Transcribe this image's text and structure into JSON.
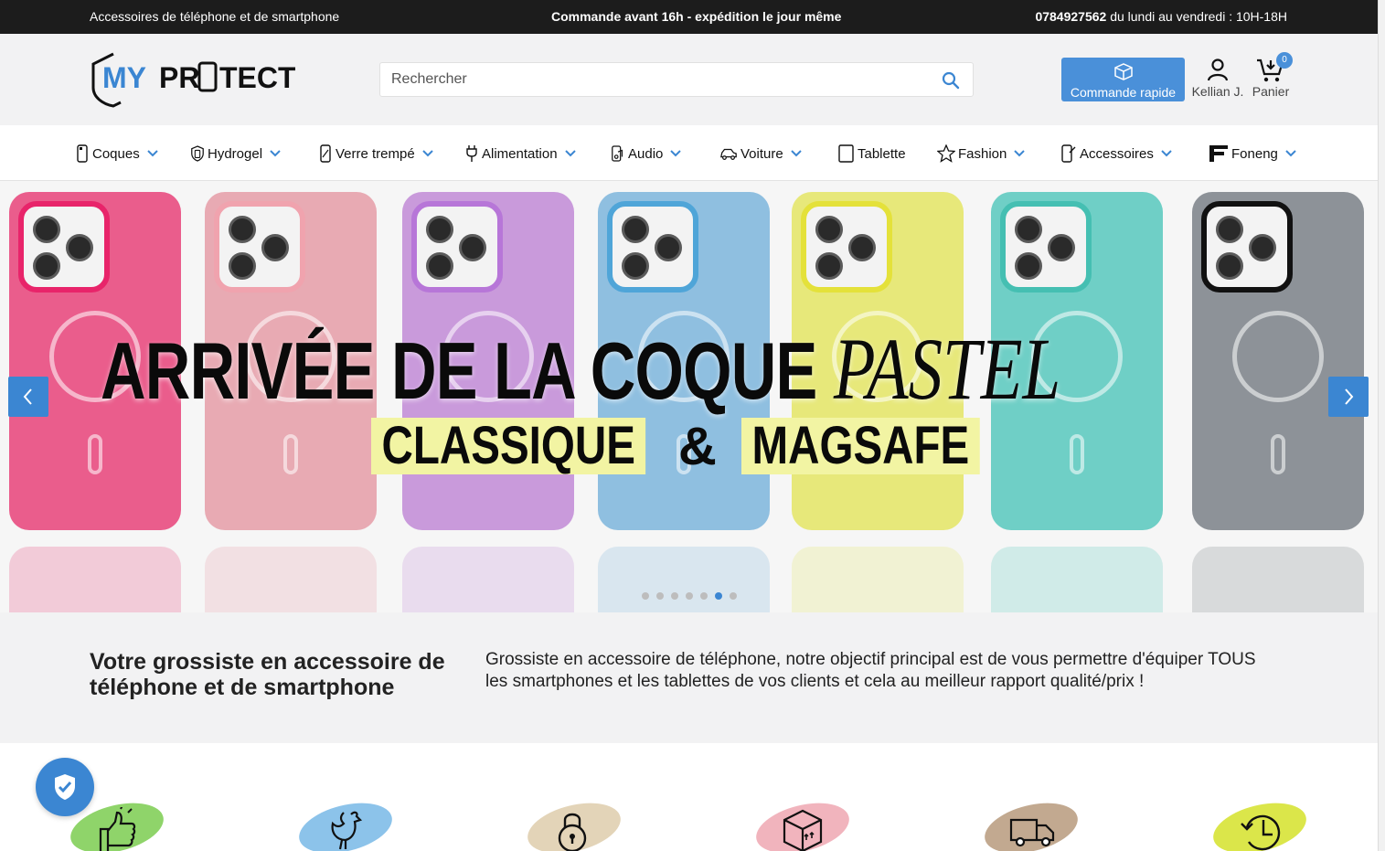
{
  "topbar": {
    "left_text": "Accessoires de téléphone et de smartphone",
    "center_text": "Commande avant 16h - expédition le jour même",
    "phone": "0784927562",
    "hours": " du lundi au vendredi : 10H-18H"
  },
  "header": {
    "logo_text": "MY PROTECT",
    "search_placeholder": "Rechercher",
    "quick_order_label": "Commande rapide",
    "account_label": "Kellian J.",
    "cart_label": "Panier",
    "cart_count": "0"
  },
  "nav": {
    "items": [
      {
        "label": "Coques",
        "icon": "phone-case-icon",
        "has_dropdown": true
      },
      {
        "label": "Hydrogel",
        "icon": "shield-icon",
        "has_dropdown": true
      },
      {
        "label": "Verre trempé",
        "icon": "tempered-glass-icon",
        "has_dropdown": true
      },
      {
        "label": "Alimentation",
        "icon": "charger-plug-icon",
        "has_dropdown": true
      },
      {
        "label": "Audio",
        "icon": "audio-icon",
        "has_dropdown": true
      },
      {
        "label": "Voiture",
        "icon": "car-icon",
        "has_dropdown": true
      },
      {
        "label": "Tablette",
        "icon": "tablet-icon",
        "has_dropdown": false
      },
      {
        "label": "Fashion",
        "icon": "star-icon",
        "has_dropdown": true
      },
      {
        "label": "Accessoires",
        "icon": "accessories-icon",
        "has_dropdown": true
      },
      {
        "label": "Foneng",
        "icon": "foneng-logo-icon",
        "has_dropdown": true
      }
    ]
  },
  "hero": {
    "headline_main": "ARRIVÉE DE LA COQUE ",
    "headline_italic": "PASTEL",
    "tag_left": "CLASSIQUE",
    "tag_amp": "&",
    "tag_right": "MAGSAFE",
    "slide_count": 7,
    "active_slide": 6,
    "case_colors": [
      "#ea5d8c",
      "#e8aab3",
      "#c99adb",
      "#8fbfe0",
      "#e7e87a",
      "#6fcfc6",
      "#8d9298"
    ],
    "bumper_colors": [
      "#e8246a",
      "#f0a3ae",
      "#b776d8",
      "#4fa5d8",
      "#e4e13a",
      "#45bfb2",
      "#111111"
    ]
  },
  "intro": {
    "title": "Votre grossiste en accessoire de téléphone et de smartphone",
    "text": "Grossiste en accessoire de téléphone, notre objectif principal est de vous permettre d'équiper TOUS les smartphones et les tablettes de vos clients et cela au meilleur rapport qualité/prix !"
  },
  "features": [
    {
      "icon": "thumbs-up-icon",
      "color": "#8fd46a"
    },
    {
      "icon": "rooster-icon",
      "color": "#8cc3ea"
    },
    {
      "icon": "padlock-icon",
      "color": "#e3d4b8"
    },
    {
      "icon": "package-icon",
      "color": "#f1b4bd"
    },
    {
      "icon": "delivery-truck-icon",
      "color": "#c2a990"
    },
    {
      "icon": "clock-icon",
      "color": "#dbe64a"
    }
  ],
  "colors": {
    "accent": "#3b86d2",
    "topbar_bg": "#1c1c1c",
    "header_bg": "#f2f2f3"
  }
}
